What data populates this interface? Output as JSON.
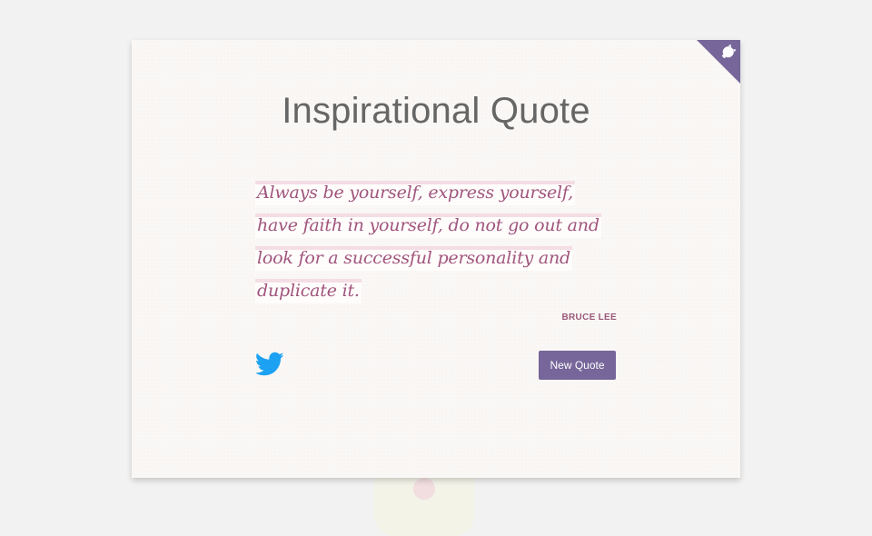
{
  "page": {
    "title": "Inspirational Quote"
  },
  "quote": {
    "text": "Always be yourself, express yourself, have faith in yourself, do not go out and look for a successful personality and duplicate it.",
    "author": "BRUCE LEE"
  },
  "actions": {
    "new_quote_label": "New Quote",
    "tweet_icon": "twitter-icon"
  },
  "corner": {
    "icon": "github-octocat-icon",
    "color": "#76669a"
  },
  "colors": {
    "accent": "#76669a",
    "quote_text": "#a0557c",
    "twitter_blue": "#1da1f2",
    "title_text": "#666666",
    "background": "#f2f2f2"
  }
}
